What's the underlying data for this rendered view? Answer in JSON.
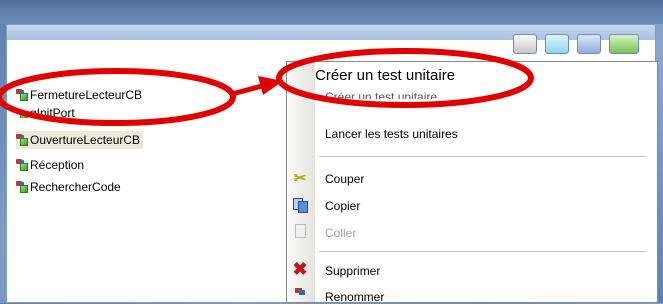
{
  "tree": {
    "items": [
      {
        "label": "FermetureLecteurCB"
      },
      {
        "label": "gInitPort"
      },
      {
        "label": "OuvertureLecteurCB"
      },
      {
        "label": "Réception"
      },
      {
        "label": "RechercherCode"
      }
    ]
  },
  "context_menu": {
    "highlighted_label": "Créer un test unitaire",
    "overlap_label": "Créer un test unitaire",
    "run_tests_label": "Lancer les tests unitaires",
    "cut_label": "Couper",
    "copy_label": "Copier",
    "paste_label": "Coller",
    "delete_label": "Supprimer",
    "rename_label": "Renommer"
  },
  "annotation": {
    "color": "#e00000"
  }
}
